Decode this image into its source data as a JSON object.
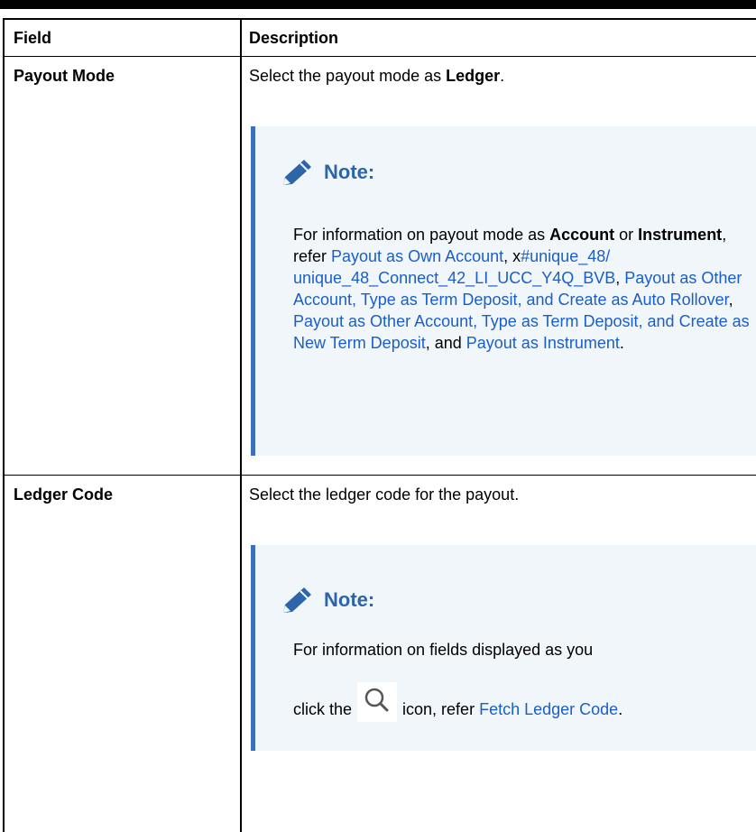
{
  "table": {
    "headers": {
      "field": "Field",
      "description": "Description"
    },
    "rows": [
      {
        "field": "Payout Mode",
        "desc_pre": "Select the payout mode as ",
        "desc_bold": "Ledger",
        "desc_post": ".",
        "note": {
          "title": "Note:",
          "t1": "For information on payout mode as ",
          "b1": "Account",
          "t2": " or ",
          "b2": "Instrument",
          "t3": ", refer ",
          "l1": "Payout as Own Account",
          "t4": ", x",
          "l2": "#unique_48/ unique_48_Connect_42_LI_UCC_Y4Q_BVB",
          "t5": ", ",
          "l3": "Payout as Other Account, Type as Term Deposit, and Create as Auto Rollover",
          "t6": ", ",
          "l4": "Payout as Other Account, Type as Term Deposit, and Create as New Term Deposit",
          "t7": ", and ",
          "l5": "Payout as Instrument",
          "t8": "."
        }
      },
      {
        "field": "Ledger Code",
        "desc": "Select the ledger code for the payout.",
        "note": {
          "title": "Note:",
          "t1": "For information on fields displayed as you click the",
          "t2": "icon, refer ",
          "l1": "Fetch Ledger Code",
          "t3": "."
        }
      }
    ]
  },
  "icons": {
    "note_icon": "pencil-icon",
    "inline_icon": "search-icon"
  },
  "colors": {
    "note_bg": "#f1f6fb",
    "note_border": "#3e6fb8",
    "note_title": "#2d65a8",
    "link": "#1a5fc7"
  }
}
